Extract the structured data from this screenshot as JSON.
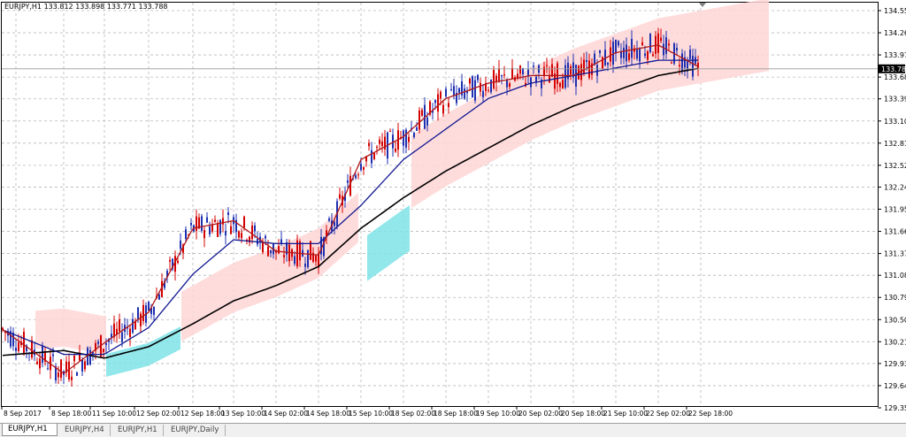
{
  "header": {
    "symbol_info": "EURJPY,H1",
    "ohlc": "133.812 133.898 133.771 133.788"
  },
  "price_axis": {
    "labels": [
      "134.550",
      "134.260",
      "133.970",
      "133.680",
      "133.395",
      "133.105",
      "132.815",
      "132.525",
      "132.240",
      "131.950",
      "131.660",
      "131.370",
      "131.085",
      "130.795",
      "130.505",
      "130.215",
      "129.930",
      "129.640",
      "129.350"
    ],
    "current_price": "133.788"
  },
  "time_axis": {
    "labels": [
      "8 Sep 2017",
      "8 Sep 18:00",
      "11 Sep 10:00",
      "12 Sep 02:00",
      "12 Sep 18:00",
      "13 Sep 10:00",
      "14 Sep 02:00",
      "14 Sep 18:00",
      "15 Sep 10:00",
      "18 Sep 02:00",
      "18 Sep 18:00",
      "19 Sep 10:00",
      "20 Sep 02:00",
      "20 Sep 18:00",
      "21 Sep 10:00",
      "22 Sep 02:00",
      "22 Sep 18:00"
    ]
  },
  "tabs": [
    {
      "label": "EURJPY,H1",
      "active": true
    },
    {
      "label": "EURJPY,H4",
      "active": false
    },
    {
      "label": "EURJPY,H1",
      "active": false
    },
    {
      "label": "EURJPY,Daily",
      "active": false
    }
  ],
  "colors": {
    "bull_candle": "#d40000",
    "bear_candle": "#1e2fb0",
    "ma_fast": "#b01818",
    "ma_mid": "#101890",
    "ma_slow": "#000000",
    "kumo_bull": "#ffd6d6",
    "kumo_bear": "#7fe3e8",
    "grid": "#b8b8b8"
  },
  "chart_data": {
    "type": "line",
    "symbol": "EURJPY",
    "timeframe": "H1",
    "ylim": [
      129.35,
      134.6
    ],
    "x": [
      "8 Sep 2017",
      "8 Sep 18:00",
      "11 Sep 10:00",
      "12 Sep 02:00",
      "12 Sep 18:00",
      "13 Sep 10:00",
      "14 Sep 02:00",
      "14 Sep 18:00",
      "15 Sep 10:00",
      "18 Sep 02:00",
      "18 Sep 18:00",
      "19 Sep 10:00",
      "20 Sep 02:00",
      "20 Sep 18:00",
      "21 Sep 10:00",
      "22 Sep 02:00",
      "22 Sep 18:00"
    ],
    "series": [
      {
        "values": [
          130.25,
          129.8,
          130.2,
          130.6,
          131.7,
          131.8,
          131.4,
          131.35,
          132.6,
          132.9,
          133.4,
          133.6,
          133.7,
          133.7,
          134.0,
          134.1,
          133.8
        ]
      },
      {
        "values": [
          130.3,
          130.05,
          130.05,
          130.4,
          131.1,
          131.55,
          131.5,
          131.5,
          132.0,
          132.6,
          133.0,
          133.4,
          133.6,
          133.7,
          133.8,
          133.9,
          133.9
        ]
      },
      {
        "values": [
          130.05,
          130.1,
          130.0,
          130.15,
          130.45,
          130.75,
          130.95,
          131.2,
          131.7,
          132.1,
          132.45,
          132.75,
          133.05,
          133.3,
          133.5,
          133.7,
          133.8
        ]
      }
    ]
  }
}
